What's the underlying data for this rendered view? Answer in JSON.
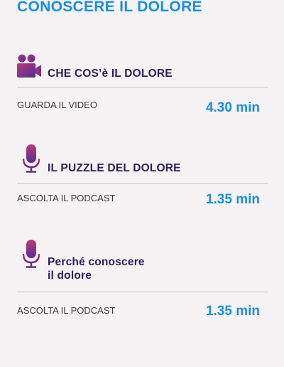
{
  "header": {
    "title": "CONOSCERE IL DOLORE"
  },
  "items": [
    {
      "icon": "video-camera-icon",
      "title": "CHE COS’è IL DOLORE",
      "action": "GUARDA IL VIDEO",
      "duration": "4.30 min"
    },
    {
      "icon": "microphone-icon",
      "title": "IL PUZZLE DEL DOLORE",
      "action": "ASCOLTA IL PODCAST",
      "duration": "1.35 min"
    },
    {
      "icon": "microphone-icon",
      "title_line1": "Perché conoscere",
      "title_line2": "il dolore",
      "action": "ASCOLTA IL PODCAST",
      "duration": "1.35 min"
    }
  ],
  "colors": {
    "accent_blue": "#1a8ee8",
    "title_navy": "#2a1e5c",
    "icon_gradient_start": "#c2357e",
    "icon_gradient_end": "#4a2f8f",
    "background": "#f6f3f5"
  }
}
